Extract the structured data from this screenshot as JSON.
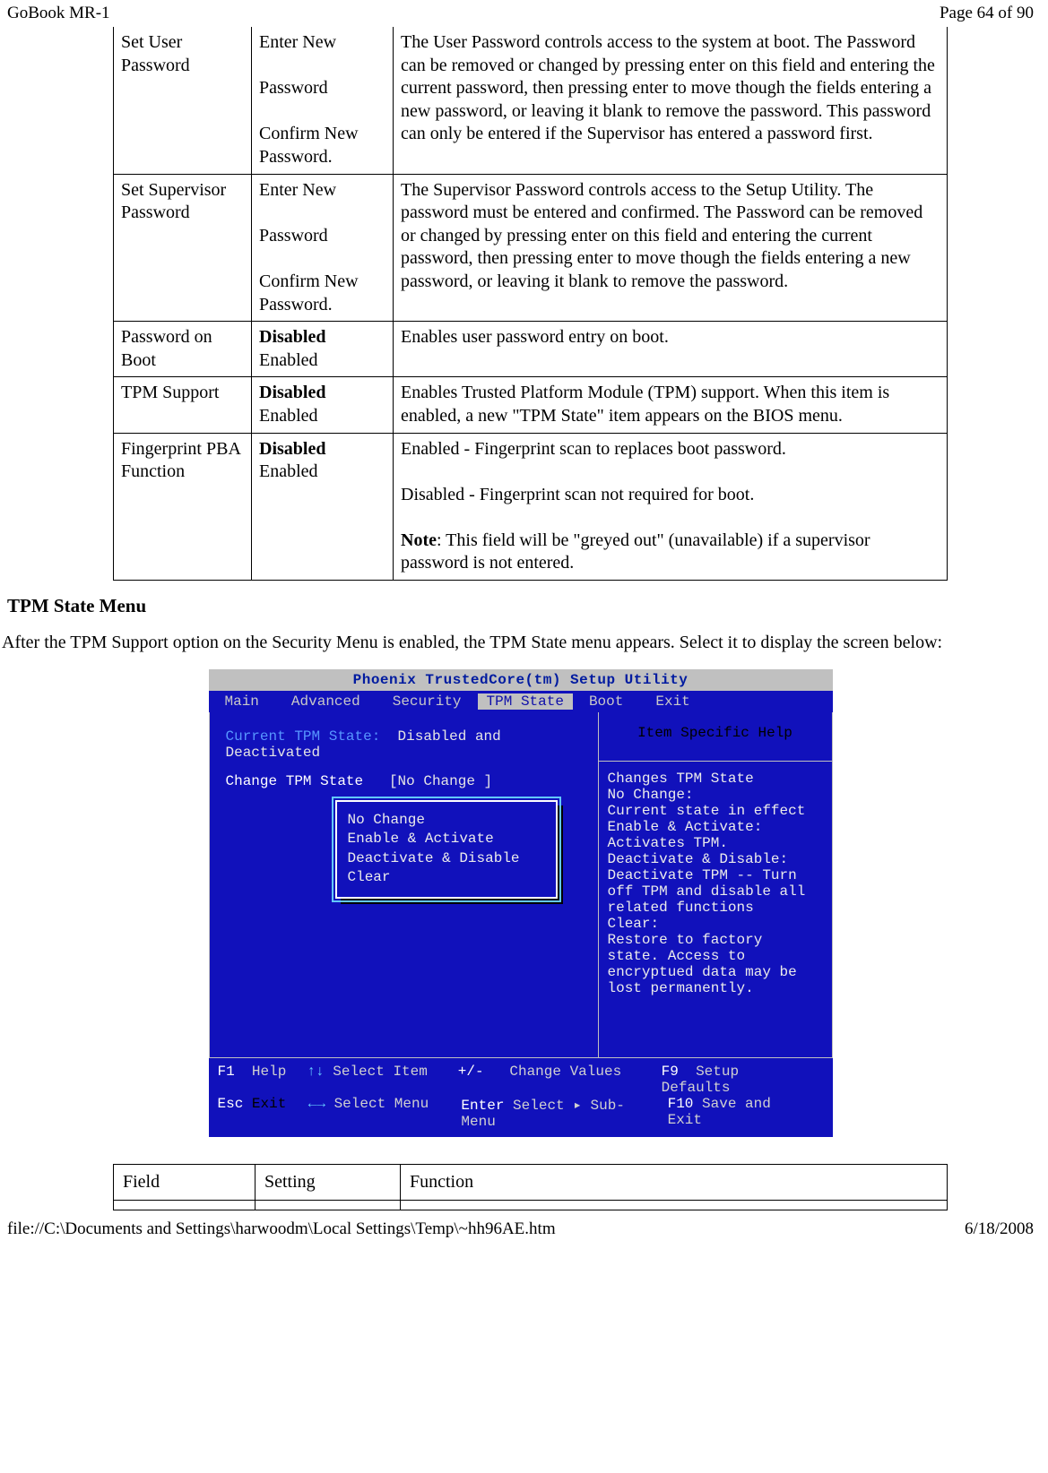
{
  "header": {
    "left": "GoBook MR-1",
    "right": "Page 64 of 90"
  },
  "footer": {
    "left": "file://C:\\Documents and Settings\\harwoodm\\Local Settings\\Temp\\~hh96AE.htm",
    "right": "6/18/2008"
  },
  "table1": {
    "rows": [
      {
        "field": "Set User Password",
        "setting_html": "Enter New<br><br>Password<br><br>Confirm New Password.",
        "func": "The User Password controls access to the system at boot. The Password can be removed or changed  by pressing enter on this field and entering the current password, then pressing enter to move though the fields entering a new password, or leaving it blank to remove the password.  This password can only be entered if the Supervisor has entered a password first."
      },
      {
        "field": "Set Supervisor Password",
        "setting_html": "Enter New<br><br>Password<br><br>Confirm New Password.",
        "func": "The Supervisor Password controls access to the Setup Utility.  The password must be entered and confirmed.  The Password can be removed or changed  by pressing enter on this field and entering the current password, then pressing enter to move though the fields entering a new password, or leaving it blank to remove the password."
      },
      {
        "field": "Password on Boot",
        "setting_html": "<b class='strong'>Disabled</b><br>Enabled",
        "func": "Enables user  password entry on boot."
      },
      {
        "field": "TPM Support",
        "setting_html": "<b class='strong'>Disabled</b><br>Enabled",
        "func": "Enables Trusted Platform Module (TPM) support.  When this item is enabled, a new \"TPM State\" item appears on the BIOS menu."
      },
      {
        "field": "Fingerprint PBA Function",
        "setting_html": "<b class='strong'>Disabled</b><br>Enabled",
        "func_html": "Enabled - Fingerprint scan to replaces boot password.<br><br>Disabled - Fingerprint scan not required for boot.<br><br><b class='strong'>Note</b>: This field will be \"greyed out\" (unavailable) if a supervisor password is not entered."
      }
    ]
  },
  "heading": "TPM State Menu",
  "para": "After the TPM Support option on the Security Menu is enabled, the TPM State menu appears.  Select it to display the screen below:",
  "bios": {
    "title": "Phoenix TrustedCore(tm) Setup Utility",
    "menu": [
      "Main",
      "Advanced",
      "Security",
      "TPM State",
      "Boot",
      "Exit"
    ],
    "active_menu_index": 3,
    "left": {
      "line1a": "Current TPM State:",
      "line1b": "Disabled and Deactivated",
      "line2a": "Change TPM State",
      "line2b": "[No Change   ]"
    },
    "popup": [
      "No Change",
      "Enable & Activate",
      "Deactivate & Disable",
      "Clear"
    ],
    "right": {
      "title": "Item Specific Help",
      "lines": [
        "Changes TPM State",
        "No Change:",
        " Current state in effect",
        "Enable & Activate:",
        " Activates TPM.",
        "Deactivate & Disable:",
        " Deactivate TPM -- Turn",
        " off TPM and disable all",
        " related functions",
        "Clear:",
        " Restore to factory",
        " state.  Access to",
        " encryptued data may be",
        " lost permanently."
      ]
    },
    "footer": {
      "r1": [
        {
          "key": "F1",
          "label": "Help"
        },
        {
          "arrow": "↑↓",
          "label": "Select Item"
        },
        {
          "key": "+/-",
          "label": "Change Values"
        },
        {
          "key": "F9",
          "label": "Setup Defaults"
        }
      ],
      "r2": [
        {
          "key": "Esc",
          "label": "Exit"
        },
        {
          "arrow": "←→",
          "label": "Select Menu"
        },
        {
          "key": "Enter",
          "label": "Select ▸ Sub-Menu"
        },
        {
          "key": "F10",
          "label": "Save and Exit"
        }
      ]
    }
  },
  "table2": {
    "headers": [
      "Field",
      "Setting",
      "Function"
    ]
  }
}
